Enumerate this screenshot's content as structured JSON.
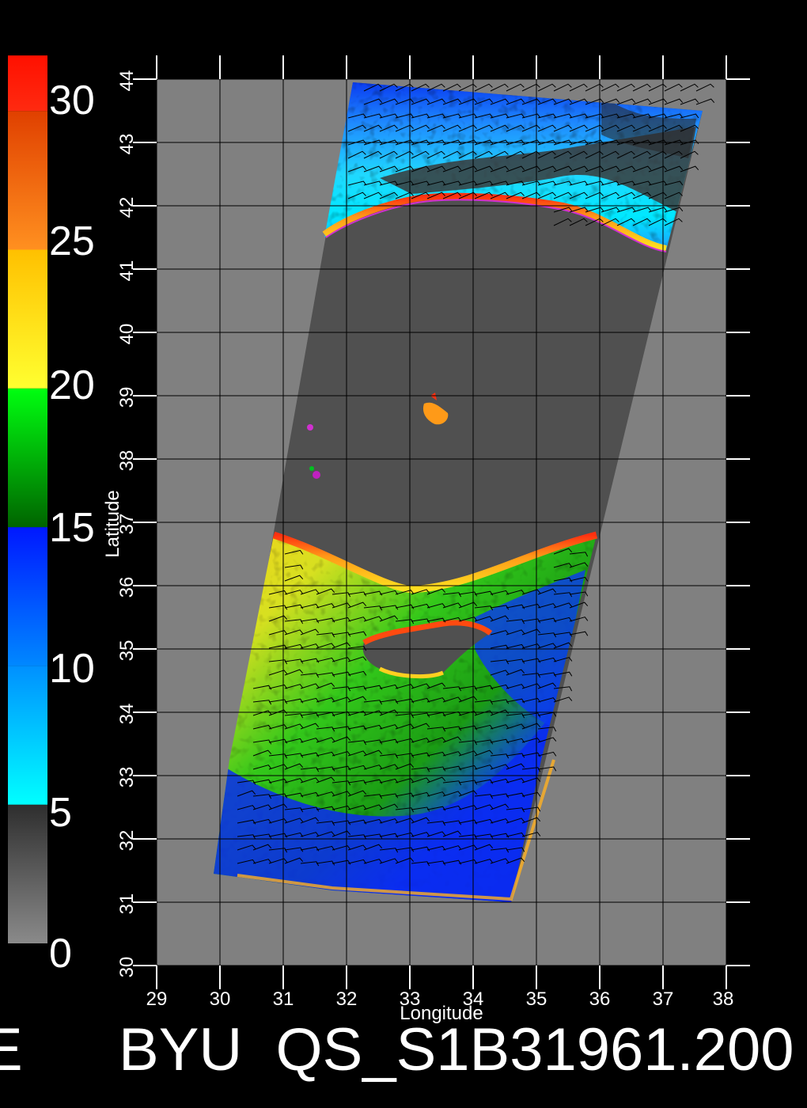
{
  "colorbar": {
    "ticks": [
      "0",
      "5",
      "10",
      "15",
      "20",
      "25",
      "30"
    ],
    "tick_values": [
      0,
      5,
      10,
      15,
      20,
      25,
      30
    ],
    "bands": [
      {
        "from": 0,
        "to": 5,
        "colors": [
          "#8a8a8a",
          "#2e2e2e"
        ]
      },
      {
        "from": 5,
        "to": 10,
        "colors": [
          "#00ffff",
          "#0090ff"
        ]
      },
      {
        "from": 10,
        "to": 15,
        "colors": [
          "#0088ff",
          "#0018ff"
        ]
      },
      {
        "from": 15,
        "to": 20,
        "colors": [
          "#006400",
          "#00ff10"
        ]
      },
      {
        "from": 20,
        "to": 25,
        "colors": [
          "#ffff30",
          "#ffc000"
        ]
      },
      {
        "from": 25,
        "to": 30,
        "colors": [
          "#ff9020",
          "#e04000"
        ]
      },
      {
        "from": 30,
        "to": 32,
        "colors": [
          "#ff2a10",
          "#ff1000"
        ]
      }
    ]
  },
  "map": {
    "xlabel": "Longitude",
    "ylabel": "Latitude",
    "x_ticks": [
      "29",
      "30",
      "31",
      "32",
      "33",
      "34",
      "35",
      "36",
      "37",
      "38"
    ],
    "y_ticks": [
      "30",
      "31",
      "32",
      "33",
      "34",
      "35",
      "36",
      "37",
      "38",
      "39",
      "40",
      "41",
      "42",
      "43",
      "44"
    ],
    "lon_range": [
      29,
      38
    ],
    "lat_range": [
      30,
      44
    ],
    "background_color": "#808080",
    "land_color": "#505050",
    "grid": true
  },
  "footer": {
    "title_fragment": "BYU  QS_S1B31961.200"
  }
}
